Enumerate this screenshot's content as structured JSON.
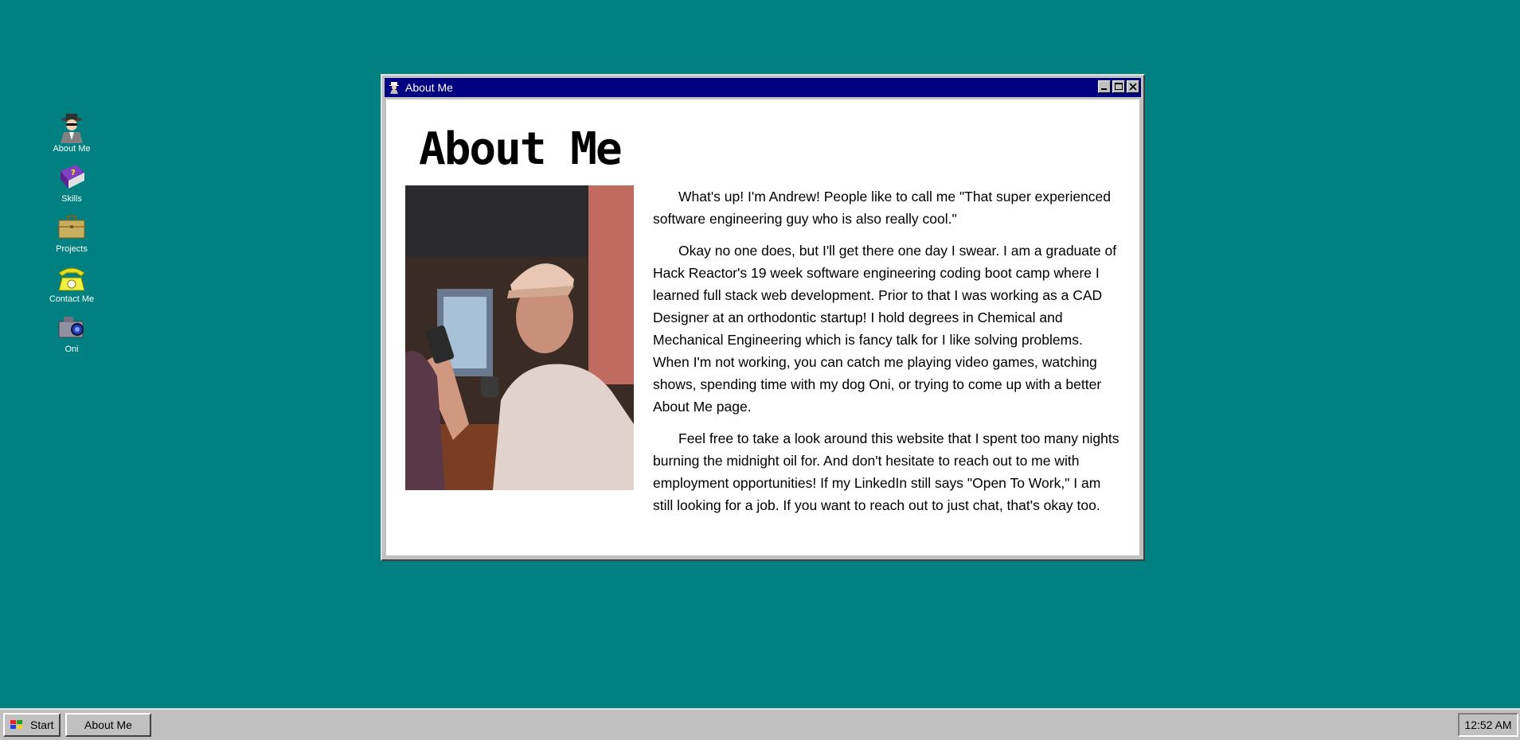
{
  "desktop": {
    "icons": [
      {
        "label": "About Me",
        "icon": "spy-icon"
      },
      {
        "label": "Skills",
        "icon": "book-icon"
      },
      {
        "label": "Projects",
        "icon": "briefcase-icon"
      },
      {
        "label": "Contact Me",
        "icon": "telephone-icon"
      },
      {
        "label": "Oni",
        "icon": "camera-icon"
      }
    ]
  },
  "window": {
    "title": "About Me",
    "heading": "About Me",
    "photo": {
      "icon": "portrait-photo",
      "alt": "Photo of Andrew"
    },
    "paragraphs": [
      "What's up! I'm Andrew! People like to call me \"That super experienced software engineering guy who is also really cool.\"",
      "Okay no one does, but I'll get there one day I swear. I am a graduate of Hack Reactor's 19 week software engineering coding boot camp where I learned full stack web development. Prior to that I was working as a CAD Designer at an orthodontic startup! I hold degrees in Chemical and Mechanical Engineering which is fancy talk for I like solving problems. When I'm not working, you can catch me playing video games, watching shows, spending time with my dog Oni, or trying to come up with a better About Me page.",
      "Feel free to take a look around this website that I spent too many nights burning the midnight oil for. And don't hesitate to reach out to me with employment opportunities! If my LinkedIn still says \"Open To Work,\" I am still looking for a job. If you want to reach out to just chat, that's okay too."
    ]
  },
  "taskbar": {
    "start_label": "Start",
    "open_task": "About Me",
    "clock": "12:52 AM"
  },
  "colors": {
    "desktop": "#008080",
    "titlebar": "#000080",
    "chrome": "#c0c0c0"
  }
}
